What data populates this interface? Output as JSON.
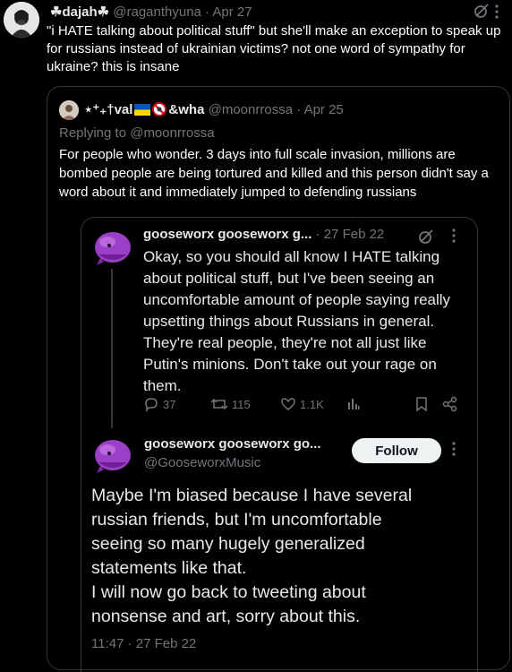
{
  "outer_tweet": {
    "display_name": "☘dajah☘",
    "handle": "@raganthyuna",
    "date": "Apr 27",
    "text": "\"i HATE talking about political stuff\" but she'll make an exception to speak up for russians instead of ukrainian victims? not one word of sympathy for ukraine? this is insane"
  },
  "quote_tweet": {
    "display_name": "⋆⁺₊†val",
    "display_name_suffix": "&wha",
    "handle": "@moonrrossa",
    "date": "Apr 25",
    "replying_to": "Replying to @moonrrossa",
    "text": "For people who wonder. 3 days into full scale invasion, millions are bombed people are being tortured and killed and this person didn't say a word about it and immediately jumped to defending russians"
  },
  "inner_tweet_1": {
    "display_name": "gooseworx gooseworx g...",
    "date": "27 Feb 22",
    "text": "Okay, so you should all know I HATE talking about political stuff, but I've been seeing an uncomfortable amount of people saying really upsetting things about Russians in general. They're real people, they're not all just like Putin's minions. Don't take out your rage on them.",
    "replies": "37",
    "retweets": "115",
    "likes": "1.1K"
  },
  "inner_tweet_2": {
    "display_name": "gooseworx gooseworx go...",
    "handle": "@GooseworxMusic",
    "follow_label": "Follow",
    "text_lines": [
      "Maybe I'm biased because I have several",
      "russian friends, but I'm uncomfortable",
      "seeing so many hugely generalized",
      "statements like that.",
      "I will now go back to tweeting about",
      "nonsense and art, sorry about this."
    ],
    "timestamp": "11:47 · 27 Feb 22"
  },
  "colors": {
    "background": "#000000",
    "text": "#e7e9ea",
    "muted": "#71767b",
    "border": "#333639",
    "ukraine_blue": "#0057b7",
    "ukraine_yellow": "#ffd700",
    "avatar_purple": "#9b3fc8"
  },
  "icons": [
    "grok-icon",
    "more-icon",
    "reply-icon",
    "retweet-icon",
    "like-icon",
    "views-icon",
    "bookmark-icon",
    "share-icon",
    "ukraine-flag-icon",
    "no-symbol-icon"
  ]
}
